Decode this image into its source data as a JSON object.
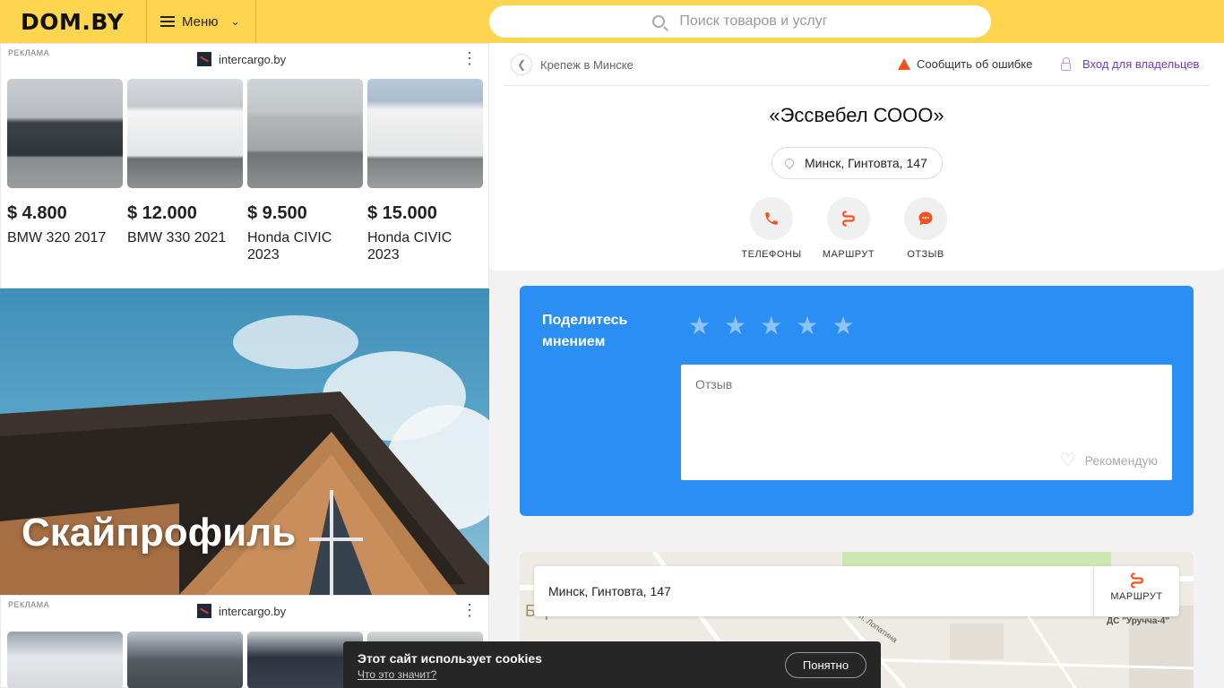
{
  "header": {
    "logo": "DOM.BY",
    "menu_label": "Меню",
    "search_placeholder": "Поиск товаров и услуг"
  },
  "ads": [
    {
      "label": "РЕКЛАМА",
      "source": "intercargo.by",
      "items": [
        {
          "price": "$ 4.800",
          "name": "BMW 320 2017",
          "color": "#3c4248"
        },
        {
          "price": "$ 12.000",
          "name": "BMW 330 2021",
          "color": "#e9e9ea"
        },
        {
          "price": "$ 9.500",
          "name": "Honda CIVIC 2023",
          "color": "#b4b6b8"
        },
        {
          "price": "$ 15.000",
          "name": "Honda CIVIC 2023",
          "color": "#f1f1f1"
        }
      ]
    },
    {
      "label": "РЕКЛАМА",
      "source": "intercargo.by",
      "items": [
        {
          "color": "#e5e7ea"
        },
        {
          "color": "#555b62"
        },
        {
          "color": "#2d3440"
        },
        {
          "color": "#8b7a62"
        }
      ]
    }
  ],
  "banner": {
    "title": "Скайпрофиль"
  },
  "company": {
    "breadcrumb": "Крепеж в Минске",
    "report_label": "Сообщить об ошибке",
    "owners_label": "Вход для владельцев",
    "name": "«Эссвебел СООО»",
    "address": "Минск, Гинтовта, 147",
    "actions": {
      "phones": "ТЕЛЕФОНЫ",
      "route": "МАРШРУТ",
      "review": "ОТЗЫВ"
    }
  },
  "review_form": {
    "title": "Поделитесь мнением",
    "rating_max": 5,
    "placeholder": "Отзыв",
    "recommend": "Рекомендую"
  },
  "map": {
    "address": "Минск, Гинтовта, 147",
    "route_label": "МАРШРУТ",
    "label_district": "Боров",
    "label_stop": "ДС \"Уручча-4\"",
    "label_street": "л. Лопатина"
  },
  "cookie": {
    "title": "Этот сайт использует cookies",
    "link": "Что это значит?",
    "button": "Понятно"
  },
  "colors": {
    "header_bg": "#ffd54f",
    "accent_orange": "#f4511e",
    "review_blue": "#2b8ef2",
    "owners_purple": "#6a3fb5"
  }
}
